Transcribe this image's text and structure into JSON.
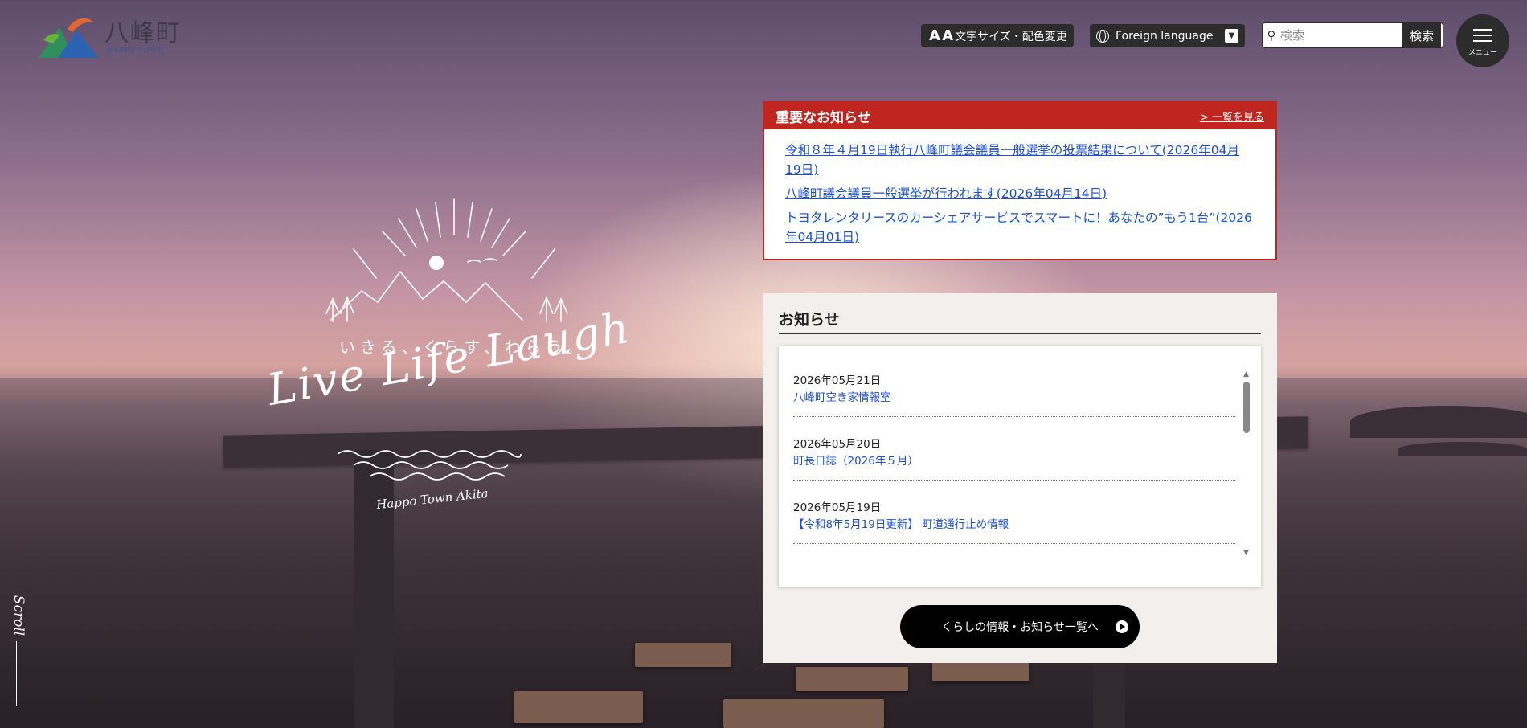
{
  "header": {
    "logo_text": "八峰町",
    "logo_sub": "HAPPO TOWN",
    "textsize_label": "文字サイズ・配色変更",
    "textsize_glyph": "A A",
    "language_label": "Foreign language",
    "search_placeholder": "検索",
    "search_button": "検索",
    "menu_label": "メニュー"
  },
  "important": {
    "title": "重要なお知らせ",
    "more_label": "> 一覧を見る",
    "items": [
      "令和８年４月19日執行八峰町議会議員一般選挙の投票結果について(2026年04月19日)",
      "八峰町議会議員一般選挙が行われます(2026年04月14日)",
      "トヨタレンタリースのカーシェアサービスでスマートに！あなたの”もう1台”(2026年04月01日)"
    ]
  },
  "news": {
    "title": "お知らせ",
    "items": [
      {
        "date": "2026年05月21日",
        "title": "八峰町空き家情報室"
      },
      {
        "date": "2026年05月20日",
        "title": "町長日誌（2026年５月）"
      },
      {
        "date": "2026年05月19日",
        "title": "【令和8年5月19日更新】 町道通行止め情報"
      }
    ],
    "list_button": "くらしの情報・お知らせ一覧へ"
  },
  "hero": {
    "catch_jp": "いきる、くらす、わらう。",
    "catch_en": "Live Life Laugh",
    "signature": "Happo Town Akita"
  },
  "scroll_label": "Scroll",
  "colors": {
    "accent_red": "#c0261f",
    "dark": "#2c2c2c",
    "link_blue": "#1a4fd6"
  }
}
